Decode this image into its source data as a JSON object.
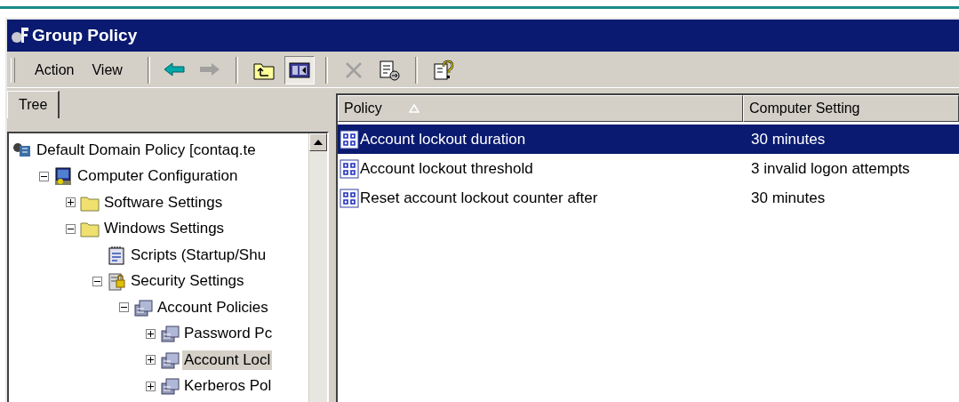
{
  "window": {
    "title": "Group Policy"
  },
  "menu": [
    {
      "label": "Action"
    },
    {
      "label": "View"
    }
  ],
  "toolbar": [
    {
      "kind": "back",
      "disabled": false,
      "pressed": false
    },
    {
      "kind": "forward",
      "disabled": true,
      "pressed": false
    },
    {
      "kind": "up",
      "disabled": false,
      "pressed": false
    },
    {
      "kind": "tree",
      "disabled": false,
      "pressed": true
    },
    {
      "kind": "delete",
      "disabled": true,
      "pressed": false
    },
    {
      "kind": "export",
      "disabled": false,
      "pressed": false
    },
    {
      "kind": "help",
      "disabled": false,
      "pressed": false
    }
  ],
  "left_tab": {
    "label": "Tree"
  },
  "tree": [
    {
      "label": "Default Domain Policy [contaq.te",
      "kind": "domain",
      "selected": false,
      "children": [
        {
          "label": "Computer Configuration",
          "kind": "computer",
          "selected": false,
          "expanded": true,
          "children": [
            {
              "label": "Software Settings",
              "kind": "folder",
              "selected": false,
              "expanded": false
            },
            {
              "label": "Windows Settings",
              "kind": "folder",
              "selected": false,
              "expanded": true,
              "children": [
                {
                  "label": "Scripts (Startup/Shu",
                  "kind": "script",
                  "selected": false
                },
                {
                  "label": "Security Settings",
                  "kind": "security",
                  "selected": false,
                  "expanded": true,
                  "children": [
                    {
                      "label": "Account Policies",
                      "kind": "policy",
                      "selected": false,
                      "expanded": true,
                      "children": [
                        {
                          "label": "Password Pc",
                          "kind": "policy",
                          "selected": false,
                          "expanded": false
                        },
                        {
                          "label": "Account Locl",
                          "kind": "policy",
                          "selected": true,
                          "expanded": false
                        },
                        {
                          "label": "Kerberos Pol",
                          "kind": "policy",
                          "selected": false,
                          "expanded": false
                        }
                      ]
                    }
                  ]
                }
              ]
            }
          ]
        }
      ]
    }
  ],
  "table": {
    "columns": [
      {
        "label": "Policy",
        "sorted": true
      },
      {
        "label": "Computer Setting",
        "sorted": false
      }
    ],
    "rows": [
      {
        "policy": "Account lockout duration",
        "setting": "30 minutes",
        "selected": true
      },
      {
        "policy": "Account lockout threshold",
        "setting": "3 invalid logon attempts",
        "selected": false
      },
      {
        "policy": "Reset account lockout counter after",
        "setting": "30 minutes",
        "selected": false
      }
    ]
  }
}
